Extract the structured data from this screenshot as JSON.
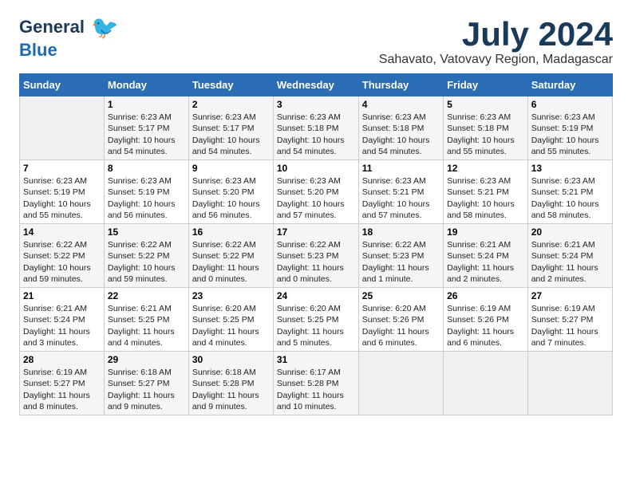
{
  "logo": {
    "line1": "General",
    "line2": "Blue"
  },
  "title": {
    "month_year": "July 2024",
    "location": "Sahavato, Vatovavy Region, Madagascar"
  },
  "days_of_week": [
    "Sunday",
    "Monday",
    "Tuesday",
    "Wednesday",
    "Thursday",
    "Friday",
    "Saturday"
  ],
  "weeks": [
    [
      {
        "day": "",
        "content": ""
      },
      {
        "day": "1",
        "content": "Sunrise: 6:23 AM\nSunset: 5:17 PM\nDaylight: 10 hours\nand 54 minutes."
      },
      {
        "day": "2",
        "content": "Sunrise: 6:23 AM\nSunset: 5:17 PM\nDaylight: 10 hours\nand 54 minutes."
      },
      {
        "day": "3",
        "content": "Sunrise: 6:23 AM\nSunset: 5:18 PM\nDaylight: 10 hours\nand 54 minutes."
      },
      {
        "day": "4",
        "content": "Sunrise: 6:23 AM\nSunset: 5:18 PM\nDaylight: 10 hours\nand 54 minutes."
      },
      {
        "day": "5",
        "content": "Sunrise: 6:23 AM\nSunset: 5:18 PM\nDaylight: 10 hours\nand 55 minutes."
      },
      {
        "day": "6",
        "content": "Sunrise: 6:23 AM\nSunset: 5:19 PM\nDaylight: 10 hours\nand 55 minutes."
      }
    ],
    [
      {
        "day": "7",
        "content": "Sunrise: 6:23 AM\nSunset: 5:19 PM\nDaylight: 10 hours\nand 55 minutes."
      },
      {
        "day": "8",
        "content": "Sunrise: 6:23 AM\nSunset: 5:19 PM\nDaylight: 10 hours\nand 56 minutes."
      },
      {
        "day": "9",
        "content": "Sunrise: 6:23 AM\nSunset: 5:20 PM\nDaylight: 10 hours\nand 56 minutes."
      },
      {
        "day": "10",
        "content": "Sunrise: 6:23 AM\nSunset: 5:20 PM\nDaylight: 10 hours\nand 57 minutes."
      },
      {
        "day": "11",
        "content": "Sunrise: 6:23 AM\nSunset: 5:21 PM\nDaylight: 10 hours\nand 57 minutes."
      },
      {
        "day": "12",
        "content": "Sunrise: 6:23 AM\nSunset: 5:21 PM\nDaylight: 10 hours\nand 58 minutes."
      },
      {
        "day": "13",
        "content": "Sunrise: 6:23 AM\nSunset: 5:21 PM\nDaylight: 10 hours\nand 58 minutes."
      }
    ],
    [
      {
        "day": "14",
        "content": "Sunrise: 6:22 AM\nSunset: 5:22 PM\nDaylight: 10 hours\nand 59 minutes."
      },
      {
        "day": "15",
        "content": "Sunrise: 6:22 AM\nSunset: 5:22 PM\nDaylight: 10 hours\nand 59 minutes."
      },
      {
        "day": "16",
        "content": "Sunrise: 6:22 AM\nSunset: 5:22 PM\nDaylight: 11 hours\nand 0 minutes."
      },
      {
        "day": "17",
        "content": "Sunrise: 6:22 AM\nSunset: 5:23 PM\nDaylight: 11 hours\nand 0 minutes."
      },
      {
        "day": "18",
        "content": "Sunrise: 6:22 AM\nSunset: 5:23 PM\nDaylight: 11 hours\nand 1 minute."
      },
      {
        "day": "19",
        "content": "Sunrise: 6:21 AM\nSunset: 5:24 PM\nDaylight: 11 hours\nand 2 minutes."
      },
      {
        "day": "20",
        "content": "Sunrise: 6:21 AM\nSunset: 5:24 PM\nDaylight: 11 hours\nand 2 minutes."
      }
    ],
    [
      {
        "day": "21",
        "content": "Sunrise: 6:21 AM\nSunset: 5:24 PM\nDaylight: 11 hours\nand 3 minutes."
      },
      {
        "day": "22",
        "content": "Sunrise: 6:21 AM\nSunset: 5:25 PM\nDaylight: 11 hours\nand 4 minutes."
      },
      {
        "day": "23",
        "content": "Sunrise: 6:20 AM\nSunset: 5:25 PM\nDaylight: 11 hours\nand 4 minutes."
      },
      {
        "day": "24",
        "content": "Sunrise: 6:20 AM\nSunset: 5:25 PM\nDaylight: 11 hours\nand 5 minutes."
      },
      {
        "day": "25",
        "content": "Sunrise: 6:20 AM\nSunset: 5:26 PM\nDaylight: 11 hours\nand 6 minutes."
      },
      {
        "day": "26",
        "content": "Sunrise: 6:19 AM\nSunset: 5:26 PM\nDaylight: 11 hours\nand 6 minutes."
      },
      {
        "day": "27",
        "content": "Sunrise: 6:19 AM\nSunset: 5:27 PM\nDaylight: 11 hours\nand 7 minutes."
      }
    ],
    [
      {
        "day": "28",
        "content": "Sunrise: 6:19 AM\nSunset: 5:27 PM\nDaylight: 11 hours\nand 8 minutes."
      },
      {
        "day": "29",
        "content": "Sunrise: 6:18 AM\nSunset: 5:27 PM\nDaylight: 11 hours\nand 9 minutes."
      },
      {
        "day": "30",
        "content": "Sunrise: 6:18 AM\nSunset: 5:28 PM\nDaylight: 11 hours\nand 9 minutes."
      },
      {
        "day": "31",
        "content": "Sunrise: 6:17 AM\nSunset: 5:28 PM\nDaylight: 11 hours\nand 10 minutes."
      },
      {
        "day": "",
        "content": ""
      },
      {
        "day": "",
        "content": ""
      },
      {
        "day": "",
        "content": ""
      }
    ]
  ]
}
